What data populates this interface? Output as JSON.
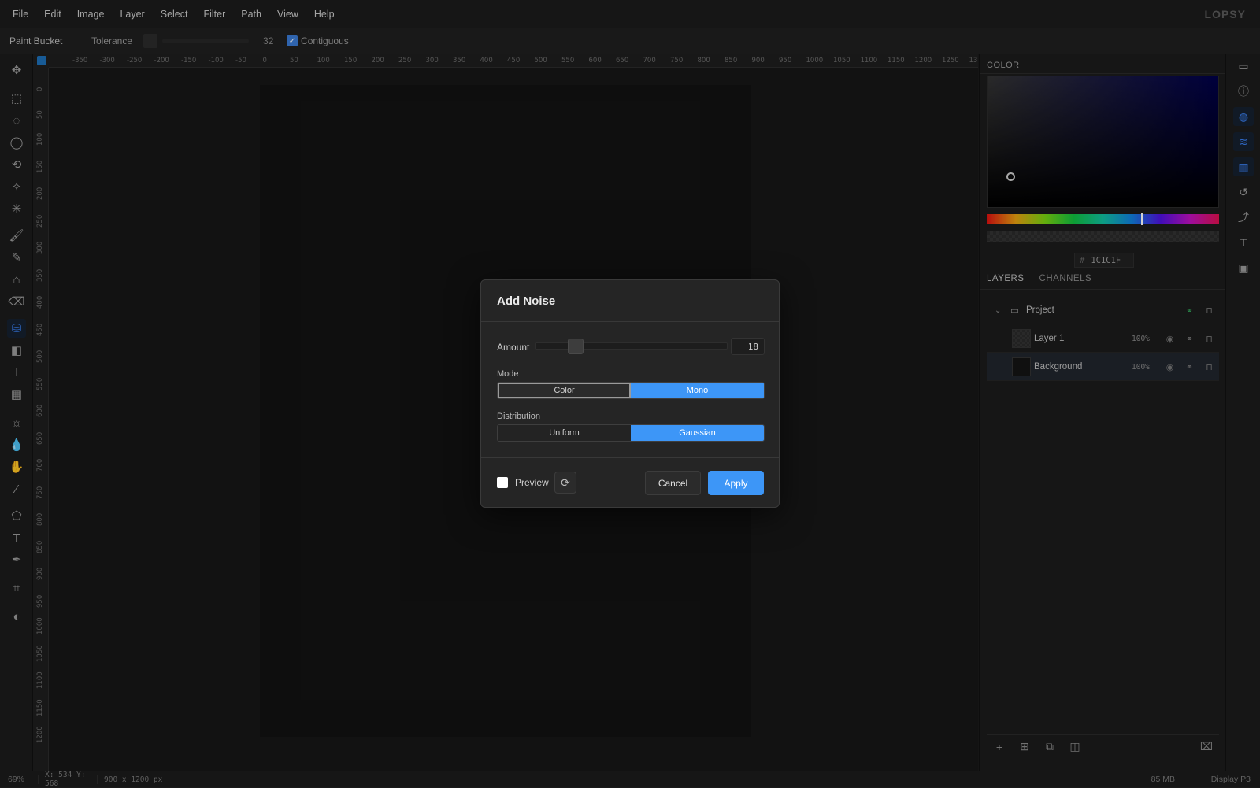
{
  "menu": [
    "File",
    "Edit",
    "Image",
    "Layer",
    "Select",
    "Filter",
    "Path",
    "View",
    "Help"
  ],
  "brand": "LOPSY",
  "options": {
    "tool_name": "Paint Bucket",
    "tolerance_label": "Tolerance",
    "tolerance_value": "32",
    "contiguous_checked": true,
    "contiguous_label": "Contiguous"
  },
  "tools": [
    {
      "name": "move-icon",
      "glyph": "✥"
    },
    {
      "name": "rect-select-icon",
      "glyph": "⬚"
    },
    {
      "name": "ellipse-select-icon",
      "glyph": "◌"
    },
    {
      "name": "lasso-icon",
      "glyph": "◯"
    },
    {
      "name": "polygon-lasso-icon",
      "glyph": "⟲"
    },
    {
      "name": "magic-wand-icon",
      "glyph": "✧"
    },
    {
      "name": "quick-select-icon",
      "glyph": "✳"
    },
    {
      "name": "brush-icon",
      "glyph": "🖌"
    },
    {
      "name": "pencil-icon",
      "glyph": "✎"
    },
    {
      "name": "clone-icon",
      "glyph": "⌂"
    },
    {
      "name": "eraser-icon",
      "glyph": "⌫"
    },
    {
      "name": "paint-bucket-icon",
      "glyph": "⛁"
    },
    {
      "name": "gradient-icon",
      "glyph": "◧"
    },
    {
      "name": "stamp-icon",
      "glyph": "⊥"
    },
    {
      "name": "pattern-icon",
      "glyph": "▦"
    },
    {
      "name": "dodge-icon",
      "glyph": "☼"
    },
    {
      "name": "blur-icon",
      "glyph": "💧"
    },
    {
      "name": "hand-icon",
      "glyph": "✋"
    },
    {
      "name": "eyedropper-icon",
      "glyph": "⁄"
    },
    {
      "name": "shape-icon",
      "glyph": "⬠"
    },
    {
      "name": "text-icon",
      "glyph": "T"
    },
    {
      "name": "pen-icon",
      "glyph": "✒"
    },
    {
      "name": "crop-icon",
      "glyph": "⌗"
    },
    {
      "name": "contrast-icon",
      "glyph": "◐"
    }
  ],
  "ruler_top": [
    "-350",
    "-300",
    "-250",
    "-200",
    "-150",
    "-100",
    "-50",
    "0",
    "50",
    "100",
    "150",
    "200",
    "250",
    "300",
    "350",
    "400",
    "450",
    "500",
    "550",
    "600",
    "650",
    "700",
    "750",
    "800",
    "850",
    "900",
    "950",
    "1000",
    "1050",
    "1100",
    "1150",
    "1200",
    "1250",
    "13"
  ],
  "ruler_left": [
    "0",
    "50",
    "100",
    "150",
    "200",
    "250",
    "300",
    "350",
    "400",
    "450",
    "500",
    "550",
    "600",
    "650",
    "700",
    "750",
    "800",
    "850",
    "900",
    "950",
    "1000",
    "1050",
    "1100",
    "1150",
    "1200"
  ],
  "color_panel": {
    "title": "COLOR",
    "hex": "1C1C1F"
  },
  "layers_panel": {
    "tabs": [
      "LAYERS",
      "CHANNELS"
    ],
    "group_name": "Project",
    "layers": [
      {
        "name": "Layer 1",
        "opacity": "100%"
      },
      {
        "name": "Background",
        "opacity": "100%"
      }
    ]
  },
  "right_strip": [
    "map-icon",
    "info-icon",
    "palette-icon",
    "layers-icon",
    "columns-icon",
    "history-icon",
    "curve-icon",
    "type-icon",
    "image-icon"
  ],
  "status": {
    "zoom": "69%",
    "coords": "X: 534 Y: 568",
    "size": "900 x 1200 px",
    "memory": "85 MB",
    "profile": "Display P3"
  },
  "dialog": {
    "title": "Add Noise",
    "amount_label": "Amount",
    "amount_value": "18",
    "amount_fraction": 0.18,
    "mode_label": "Mode",
    "mode_options": [
      "Color",
      "Mono"
    ],
    "mode_selected": "Mono",
    "distribution_label": "Distribution",
    "distribution_options": [
      "Uniform",
      "Gaussian"
    ],
    "distribution_selected": "Gaussian",
    "preview_label": "Preview",
    "preview_checked": false,
    "cancel_label": "Cancel",
    "apply_label": "Apply"
  }
}
